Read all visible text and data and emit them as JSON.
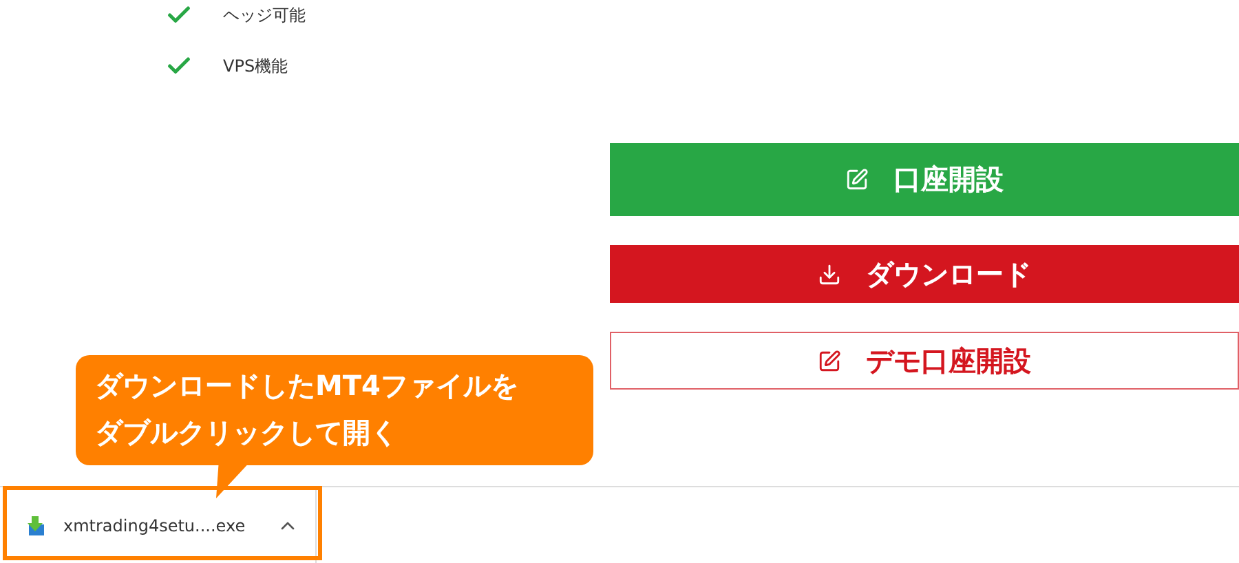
{
  "features": [
    {
      "label": "ヘッジ可能"
    },
    {
      "label": "VPS機能"
    }
  ],
  "buttons": [
    {
      "label": "口座開設",
      "kind": "green"
    },
    {
      "label": "ダウンロード",
      "kind": "red"
    },
    {
      "label": "デモ口座開設",
      "kind": "outline"
    }
  ],
  "callout": {
    "lines": [
      "ダウンロードしたMT4ファイルを",
      "ダブルクリックして開く"
    ]
  },
  "download_bar": {
    "file_name": "xmtrading4setu....exe",
    "highlighted": true
  }
}
